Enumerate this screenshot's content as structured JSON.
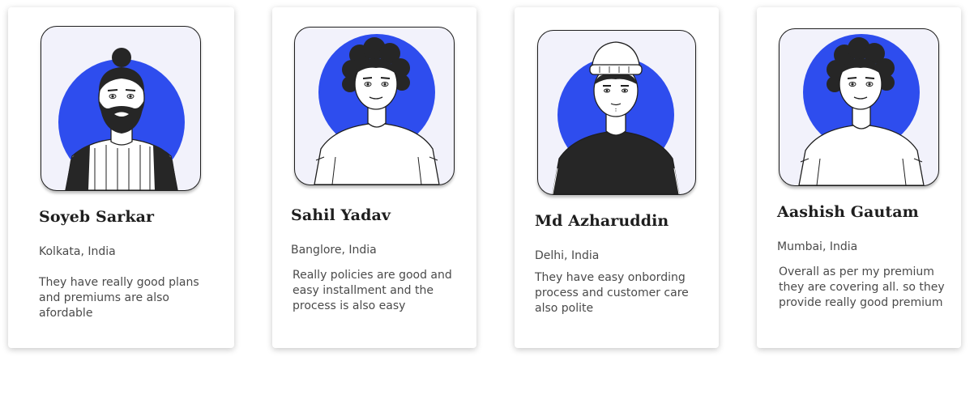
{
  "theme": {
    "accent": "#2e4dee",
    "avatar_bg": "#f2f2fb",
    "text_dark": "#1e1e1e",
    "text_muted": "#4a4a4a"
  },
  "testimonials": [
    {
      "name": "Soyeb Sarkar",
      "location": "Kolkata, India",
      "review": "They have really good plans and premiums are also afordable",
      "avatar_icon": "bearded-man-topknot-avatar"
    },
    {
      "name": "Sahil Yadav",
      "location": "Banglore, India",
      "review": "Really policies are good and easy installment and the process is also easy",
      "avatar_icon": "curly-hair-man-avatar"
    },
    {
      "name": "Md Azharuddin",
      "location": "Delhi, India",
      "review": "They have easy onbording process and customer care also polite",
      "avatar_icon": "beanie-man-avatar"
    },
    {
      "name": "Aashish Gautam",
      "location": "Mumbai, India",
      "review": "Overall as per my premium they are covering all. so they provide really good premium",
      "avatar_icon": "curly-hair-man-avatar"
    }
  ]
}
